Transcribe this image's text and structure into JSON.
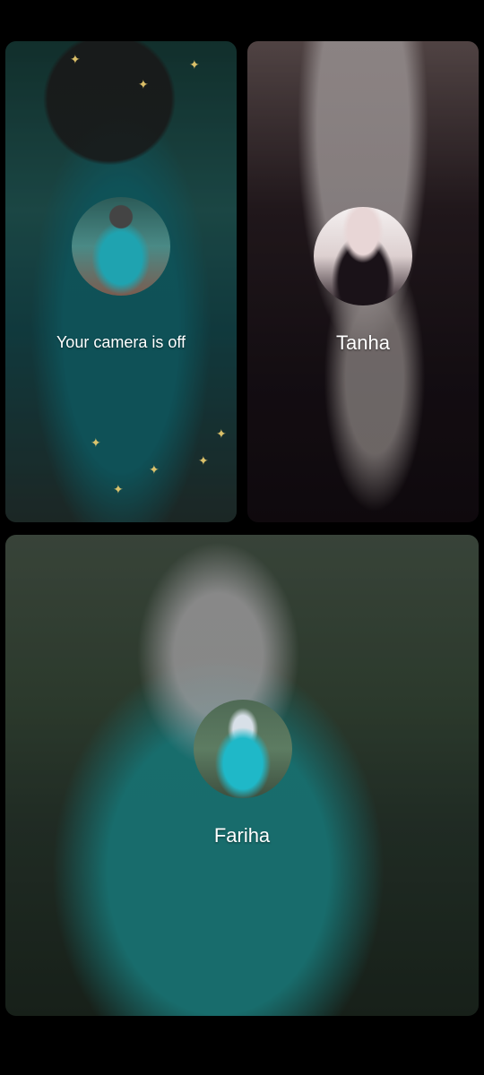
{
  "tiles": {
    "self": {
      "status_text": "Your camera is off"
    },
    "tanha": {
      "name": "Tanha"
    },
    "fariha": {
      "name": "Fariha"
    }
  },
  "colors": {
    "background": "#000000",
    "label_text": "#ffffff"
  }
}
